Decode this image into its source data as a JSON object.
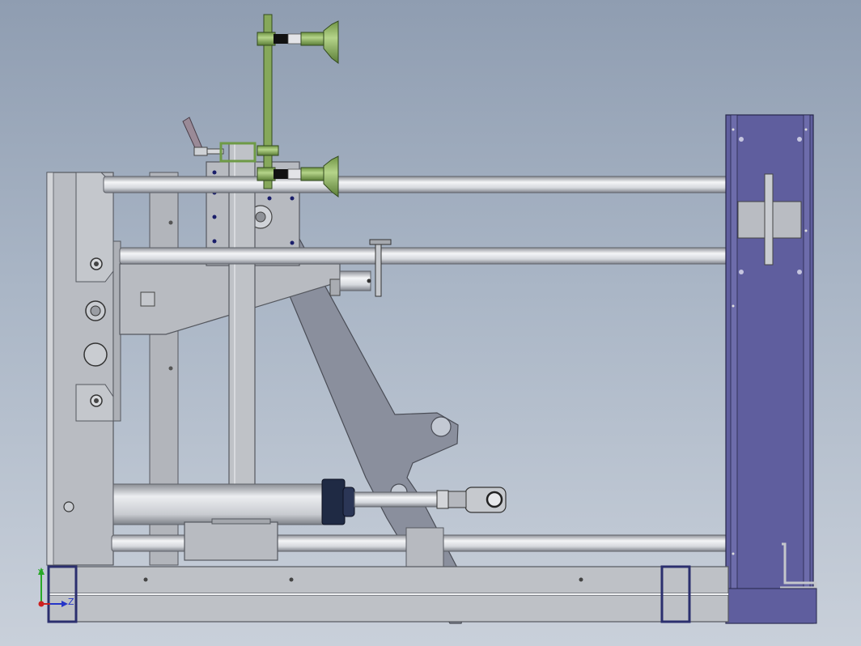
{
  "window": {
    "title": ""
  },
  "colors": {
    "background_top": "#8f9db1",
    "background_bottom": "#c9d0da",
    "frame_gray": "#b4b7bd",
    "rod_light": "#eef0f2",
    "arm_gray": "#8a8f9d",
    "post_blue": "#5f5e9e",
    "part_green": "#86a85a",
    "cylinder_cap": "#1f2a44"
  },
  "triad": {
    "y_label": "Y",
    "z_label": "Z"
  }
}
